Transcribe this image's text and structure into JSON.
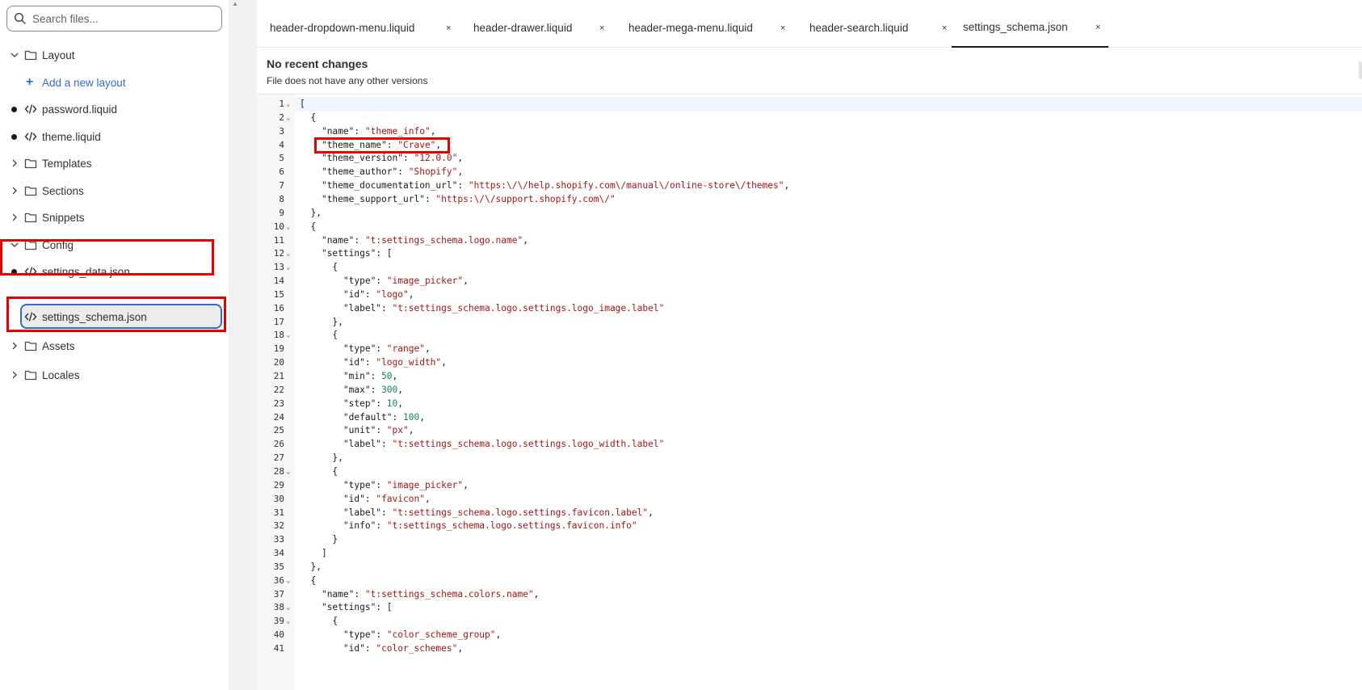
{
  "sidebar": {
    "search_placeholder": "Search files...",
    "items": [
      {
        "type": "folder",
        "label": "Layout",
        "expanded": true
      },
      {
        "type": "add",
        "label": "Add a new layout"
      },
      {
        "type": "file",
        "label": "password.liquid",
        "modified": true
      },
      {
        "type": "file",
        "label": "theme.liquid",
        "modified": true
      },
      {
        "type": "folder",
        "label": "Templates",
        "expanded": false
      },
      {
        "type": "folder",
        "label": "Sections",
        "expanded": false
      },
      {
        "type": "folder",
        "label": "Snippets",
        "expanded": false
      },
      {
        "type": "folder",
        "label": "Config",
        "expanded": true
      },
      {
        "type": "file",
        "label": "settings_data.json",
        "modified": true
      },
      {
        "type": "file",
        "label": "settings_schema.json",
        "selected": true
      },
      {
        "type": "folder",
        "label": "Assets",
        "expanded": false
      },
      {
        "type": "folder",
        "label": "Locales",
        "expanded": false
      }
    ]
  },
  "tabs": [
    {
      "label": "header-dropdown-menu.liquid",
      "close": "×"
    },
    {
      "label": "header-drawer.liquid",
      "close": "×"
    },
    {
      "label": "header-mega-menu.liquid",
      "close": "×"
    },
    {
      "label": "header-search.liquid",
      "close": "×"
    },
    {
      "label": "settings_schema.json",
      "close": "×",
      "active": true
    }
  ],
  "history": {
    "title": "No recent changes",
    "subtitle": "File does not have any other versions"
  },
  "colors": {
    "accent": "#2c6ecb",
    "annotation_red": "#e30000",
    "string": "#a31515",
    "number": "#098658"
  },
  "code_lines": [
    {
      "n": "1",
      "fold": true,
      "text": "["
    },
    {
      "n": "2",
      "fold": true,
      "text": "  {"
    },
    {
      "n": "3",
      "fold": false,
      "text": "    \"name\": \"theme_info\","
    },
    {
      "n": "4",
      "fold": false,
      "text": "    \"theme_name\": \"Crave\","
    },
    {
      "n": "5",
      "fold": false,
      "text": "    \"theme_version\": \"12.0.0\","
    },
    {
      "n": "6",
      "fold": false,
      "text": "    \"theme_author\": \"Shopify\","
    },
    {
      "n": "7",
      "fold": false,
      "text": "    \"theme_documentation_url\": \"https:\\/\\/help.shopify.com\\/manual\\/online-store\\/themes\","
    },
    {
      "n": "8",
      "fold": false,
      "text": "    \"theme_support_url\": \"https:\\/\\/support.shopify.com\\/\""
    },
    {
      "n": "9",
      "fold": false,
      "text": "  },"
    },
    {
      "n": "10",
      "fold": true,
      "text": "  {"
    },
    {
      "n": "11",
      "fold": false,
      "text": "    \"name\": \"t:settings_schema.logo.name\","
    },
    {
      "n": "12",
      "fold": true,
      "text": "    \"settings\": ["
    },
    {
      "n": "13",
      "fold": true,
      "text": "      {"
    },
    {
      "n": "14",
      "fold": false,
      "text": "        \"type\": \"image_picker\","
    },
    {
      "n": "15",
      "fold": false,
      "text": "        \"id\": \"logo\","
    },
    {
      "n": "16",
      "fold": false,
      "text": "        \"label\": \"t:settings_schema.logo.settings.logo_image.label\""
    },
    {
      "n": "17",
      "fold": false,
      "text": "      },"
    },
    {
      "n": "18",
      "fold": true,
      "text": "      {"
    },
    {
      "n": "19",
      "fold": false,
      "text": "        \"type\": \"range\","
    },
    {
      "n": "20",
      "fold": false,
      "text": "        \"id\": \"logo_width\","
    },
    {
      "n": "21",
      "fold": false,
      "text": "        \"min\": 50,"
    },
    {
      "n": "22",
      "fold": false,
      "text": "        \"max\": 300,"
    },
    {
      "n": "23",
      "fold": false,
      "text": "        \"step\": 10,"
    },
    {
      "n": "24",
      "fold": false,
      "text": "        \"default\": 100,"
    },
    {
      "n": "25",
      "fold": false,
      "text": "        \"unit\": \"px\","
    },
    {
      "n": "26",
      "fold": false,
      "text": "        \"label\": \"t:settings_schema.logo.settings.logo_width.label\""
    },
    {
      "n": "27",
      "fold": false,
      "text": "      },"
    },
    {
      "n": "28",
      "fold": true,
      "text": "      {"
    },
    {
      "n": "29",
      "fold": false,
      "text": "        \"type\": \"image_picker\","
    },
    {
      "n": "30",
      "fold": false,
      "text": "        \"id\": \"favicon\","
    },
    {
      "n": "31",
      "fold": false,
      "text": "        \"label\": \"t:settings_schema.logo.settings.favicon.label\","
    },
    {
      "n": "32",
      "fold": false,
      "text": "        \"info\": \"t:settings_schema.logo.settings.favicon.info\""
    },
    {
      "n": "33",
      "fold": false,
      "text": "      }"
    },
    {
      "n": "34",
      "fold": false,
      "text": "    ]"
    },
    {
      "n": "35",
      "fold": false,
      "text": "  },"
    },
    {
      "n": "36",
      "fold": true,
      "text": "  {"
    },
    {
      "n": "37",
      "fold": false,
      "text": "    \"name\": \"t:settings_schema.colors.name\","
    },
    {
      "n": "38",
      "fold": true,
      "text": "    \"settings\": ["
    },
    {
      "n": "39",
      "fold": true,
      "text": "      {"
    },
    {
      "n": "40",
      "fold": false,
      "text": "        \"type\": \"color_scheme_group\","
    },
    {
      "n": "41",
      "fold": false,
      "text": "        \"id\": \"color_schemes\","
    }
  ]
}
